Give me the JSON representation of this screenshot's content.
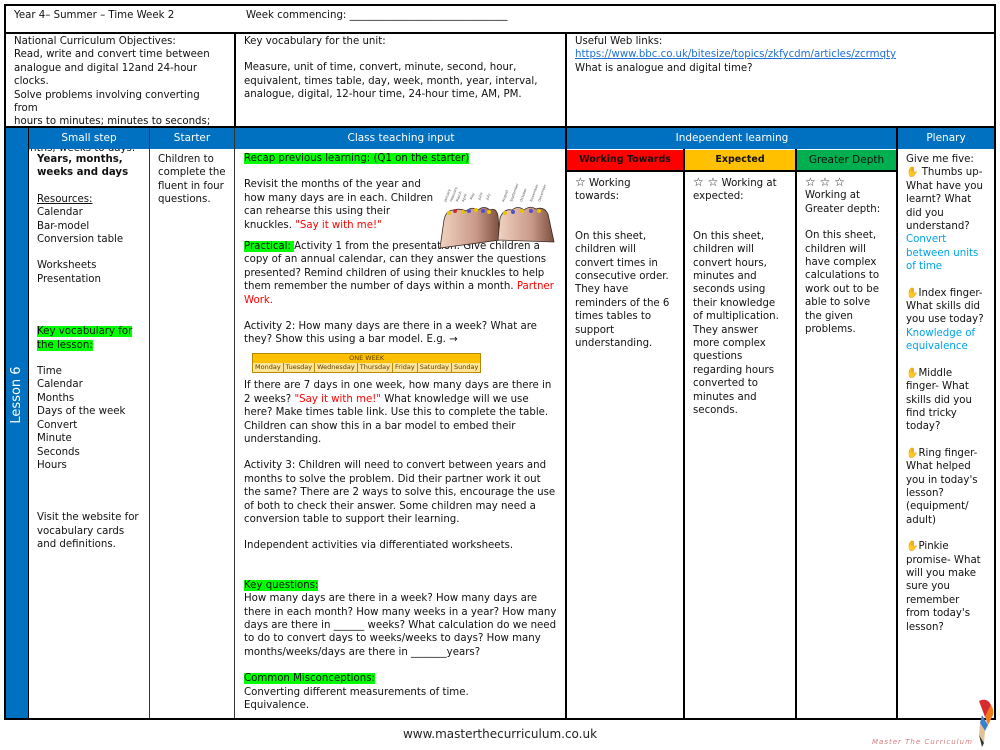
{
  "header": {
    "title": "Year 4– Summer – Time  Week 2",
    "week_commencing_label": "Week commencing: ",
    "week_commencing_blank": "_______________________________"
  },
  "objectives": {
    "heading": "National Curriculum Objectives:",
    "lines": [
      "Read, write and convert time between",
      "analogue and digital 12and 24-hour clocks.",
      "Solve problems involving converting from",
      "hours to minutes; minutes to seconds; years to",
      "months; weeks to days."
    ]
  },
  "unit_vocab": {
    "heading": "Key vocabulary for the unit:",
    "text": "Measure, unit of time, convert, minute, second, hour, equivalent, times table, day, week, month, year, interval, analogue, digital, 12-hour time, 24-hour time, AM, PM."
  },
  "web_links": {
    "heading": "Useful Web links:",
    "url": "https://www.bbc.co.uk/bitesize/topics/zkfycdm/articles/zcrmqty",
    "caption": "What is analogue and digital time?"
  },
  "columns": {
    "small_step": "Small step",
    "starter": "Starter",
    "class_teaching": "Class teaching input",
    "independent": "Independent learning",
    "plenary": "Plenary"
  },
  "lesson_label": "Lesson 6",
  "small_step": {
    "title": "Years, months, weeks and days",
    "resources_heading": "Resources:",
    "resources": [
      "Calendar",
      "Bar-model",
      "Conversion table"
    ],
    "materials": [
      "Worksheets",
      "Presentation"
    ],
    "vocab_heading_1": "Key vocabulary for",
    "vocab_heading_2": "the lesson:",
    "vocab": [
      "Time",
      "Calendar",
      "Months",
      "Days of the week",
      "Convert",
      "Minute",
      "Seconds",
      "Hours"
    ],
    "website_note": "Visit the website for vocabulary cards and definitions."
  },
  "starter": {
    "text": "Children to complete the fluent in four questions."
  },
  "teaching": {
    "recap_heading": "Recap previous learning: (Q1 on the starter)",
    "recap_text": "Revisit the months of the year and how many days are in each. Children can rehearse this using their knuckles. ",
    "recap_red": "\"Say it with me!\"",
    "practical_label": "Practical: ",
    "practical_text": " Activity 1 from the presentation: Give children a copy of an annual calendar, can they answer the questions presented? Remind children of using their knuckles to help them remember the number of days within a month. ",
    "practical_red": "Partner Work.",
    "activity2_text": "Activity 2: How many days are there in a week? What are they? Show this using a bar model.  E.g. →",
    "bar_model": {
      "title": "ONE WEEK",
      "days": [
        "Monday",
        "Tuesday",
        "Wednesday",
        "Thursday",
        "Friday",
        "Saturday",
        "Sunday"
      ]
    },
    "activity2b_pre": "If there are 7 days in one week, how many days are there in 2 weeks? ",
    "activity2b_red": "\"Say it with me!\"",
    "activity2b_post": " What knowledge will we use here? Make times table link. Use this to complete the table. Children can show this in a bar model to embed their understanding.",
    "activity3_text": "Activity 3: Children will need to convert between years and months to solve the problem. Did their partner work it out the same? There are 2 ways to solve this, encourage the use of both to check their answer. Some children may need a conversion table to support their learning.",
    "independent_text": "Independent activities via differentiated worksheets.",
    "key_questions_heading": "Key questions:",
    "key_questions_text": "How many days are there in a week? How many days are there in each month? How many weeks in a year? How many days are there in ______ weeks? What calculation do we need to do to convert days to weeks/weeks to days? How many months/weeks/days are there in _______years?",
    "misconceptions_heading": "Common Misconceptions:",
    "misconceptions": [
      "Converting different measurements of time.",
      "Equivalence."
    ],
    "knuckle_months": [
      "January",
      "February",
      "March",
      "April",
      "May",
      "June",
      "July",
      "August",
      "September",
      "October",
      "November",
      "December"
    ]
  },
  "independent": {
    "tiers": [
      {
        "label": "Working Towards",
        "color": "#ff0000",
        "stars": "☆",
        "intro": "Working towards:",
        "text": "On this sheet, children will convert times in consecutive order. They have reminders of the 6 times tables to support understanding."
      },
      {
        "label": "Expected",
        "color": "#ffc000",
        "stars": "☆ ☆",
        "intro": "Working at expected:",
        "text": "On this sheet, children will convert hours, minutes and seconds using their knowledge of multiplication. They answer more complex questions regarding hours converted to minutes and seconds."
      },
      {
        "label": "Greater Depth",
        "color": "#00b050",
        "stars": "☆ ☆ ☆",
        "intro": "Working at Greater depth:",
        "text": "On this sheet, children will have complex calculations to work out to be able to solve the given problems."
      }
    ]
  },
  "plenary": {
    "intro": "Give me five:",
    "items": [
      {
        "icon": "hand-icon",
        "text": "Thumbs up- What have you learnt? What did you understand?",
        "answer": "Convert between units of time"
      },
      {
        "icon": "hand-icon",
        "text": "Index finger- What skills did you use today?",
        "answer": "Knowledge of equivalence"
      },
      {
        "icon": "hand-icon",
        "text": "Middle finger- What skills did you find tricky today?",
        "answer": ""
      },
      {
        "icon": "hand-icon",
        "text": "Ring finger- What helped you in today's lesson? (equipment/ adult)",
        "answer": ""
      },
      {
        "icon": "hand-icon",
        "text": "Pinkie promise- What will you make sure you remember from today's lesson?",
        "answer": ""
      }
    ]
  },
  "footer": {
    "url": "www.masterthecurriculum.co.uk",
    "logo_text": "Master The Curriculum"
  },
  "colors": {
    "header_blue": "#0070c0",
    "highlight_green": "#00ff00",
    "emphasis_red": "#ff0000",
    "answer_cyan": "#00a2e8"
  }
}
